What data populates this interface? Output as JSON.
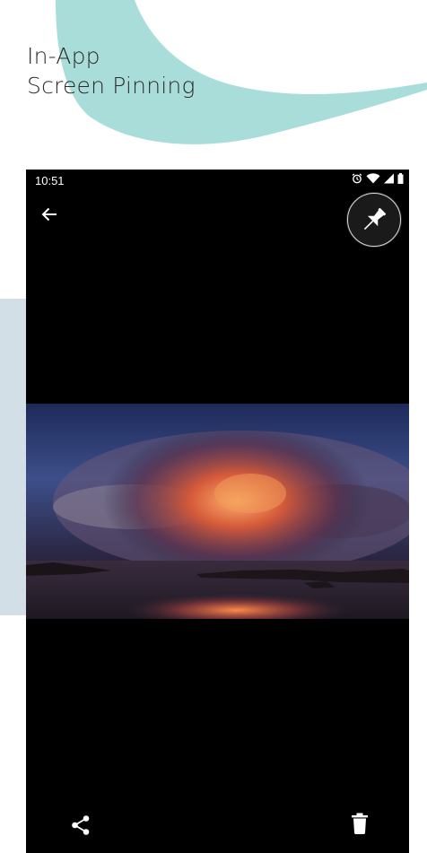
{
  "promo": {
    "headline_line1": "In-App",
    "headline_line2": "Screen Pinning",
    "accent_color": "#a9ddd9",
    "side_panel_color": "#d3dfe6"
  },
  "status_bar": {
    "time": "10:51",
    "icons": [
      "alarm-icon",
      "wifi-icon",
      "signal-icon",
      "battery-icon"
    ]
  },
  "viewer": {
    "back_icon": "arrow-left-icon",
    "pin_icon": "pushpin-icon",
    "photo_description_icon": "photo",
    "share_icon": "share-icon",
    "delete_icon": "trash-icon"
  }
}
